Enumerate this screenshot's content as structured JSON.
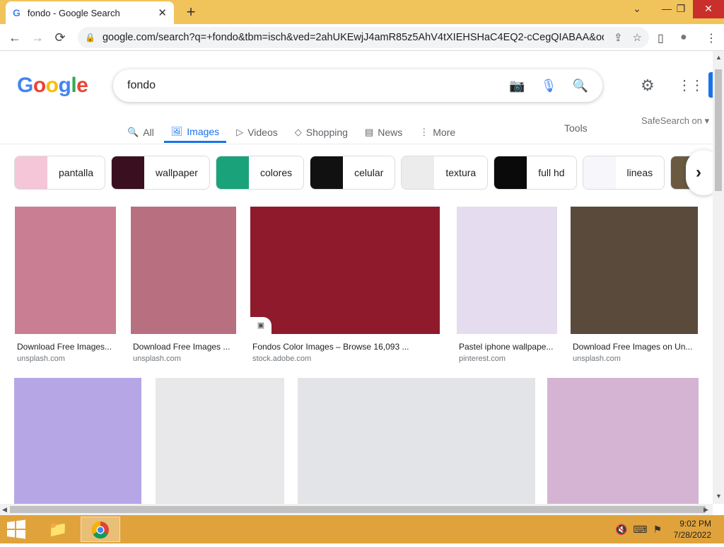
{
  "browser": {
    "tab_title": "fondo - Google Search",
    "tab_favicon": "G",
    "new_tab_label": "+",
    "close_tab_label": "✕",
    "window_controls": {
      "collapse": "⌄",
      "minimize": "—",
      "restore": "❐",
      "close": "✕"
    },
    "nav": {
      "back": "←",
      "forward": "→",
      "reload": "⟳"
    },
    "url": "google.com/search?q=+fondo&tbm=isch&ved=2ahUKEwjJ4amR85z5AhV4tXIEHSHaC4EQ2-cCegQIABAA&oq=...",
    "share_icon": "⇪",
    "star_icon": "☆",
    "sidepanel_icon": "▯",
    "profile_icon": "●",
    "menu_icon": "⋮"
  },
  "google": {
    "logo_letters": [
      {
        "ch": "G",
        "color": "#4285f4"
      },
      {
        "ch": "o",
        "color": "#ea4335"
      },
      {
        "ch": "o",
        "color": "#fbbc05"
      },
      {
        "ch": "g",
        "color": "#4285f4"
      },
      {
        "ch": "l",
        "color": "#34a853"
      },
      {
        "ch": "e",
        "color": "#ea4335"
      }
    ],
    "query": "fondo",
    "camera_icon": "📷",
    "mic_icon": "🎙",
    "search_icon": "🔍",
    "settings_icon": "⚙",
    "apps_icon": "⋮⋮⋮"
  },
  "nav_tabs": [
    {
      "label": "All",
      "icon": "🔍",
      "active": false
    },
    {
      "label": "Images",
      "icon": "🖼",
      "active": true
    },
    {
      "label": "Videos",
      "icon": "▷",
      "active": false
    },
    {
      "label": "Shopping",
      "icon": "◇",
      "active": false
    },
    {
      "label": "News",
      "icon": "▤",
      "active": false
    },
    {
      "label": "More",
      "icon": "⋮",
      "active": false
    }
  ],
  "tools_label": "Tools",
  "safesearch_label": "SafeSearch on ▾",
  "chips": [
    {
      "label": "pantalla",
      "color": "#f4c6d8"
    },
    {
      "label": "wallpaper",
      "color": "#3a1020"
    },
    {
      "label": "colores",
      "color": "#1aa37a"
    },
    {
      "label": "celular",
      "color": "#111111"
    },
    {
      "label": "textura",
      "color": "#ececec"
    },
    {
      "label": "full hd",
      "color": "#0a0a0a"
    },
    {
      "label": "lineas",
      "color": "#f7f7fb"
    },
    {
      "label": "",
      "color": "#6a5a40"
    }
  ],
  "chip_next_icon": "›",
  "results_row1": [
    {
      "caption": "Download Free Images...",
      "source": "unsplash.com",
      "color": "#c97e93",
      "badge": false
    },
    {
      "caption": "Download Free Images ...",
      "source": "unsplash.com",
      "color": "#b86f7f",
      "badge": false
    },
    {
      "caption": "Fondos Color Images – Browse 16,093 ...",
      "source": "stock.adobe.com",
      "color": "#8f1a2c",
      "badge": true
    },
    {
      "caption": "Pastel iphone wallpape...",
      "source": "pinterest.com",
      "color": "#e6dcf0",
      "badge": false
    },
    {
      "caption": "Download Free Images on Un...",
      "source": "unsplash.com",
      "color": "#5a4a3c",
      "badge": false
    }
  ],
  "results_row2": [
    {
      "color": "#b7a6e6"
    },
    {
      "color": "#e8e8ea"
    },
    {
      "color": "#e2e4e8"
    },
    {
      "color": "#d5b4d3"
    }
  ],
  "badge_icon": "▣",
  "taskbar": {
    "start_icon": "windows-logo",
    "explorer_icon": "📁",
    "chrome_icon": "◉",
    "tray_icons": "🔇⌨⚑",
    "time": "9:02 PM",
    "date": "7/28/2022"
  }
}
